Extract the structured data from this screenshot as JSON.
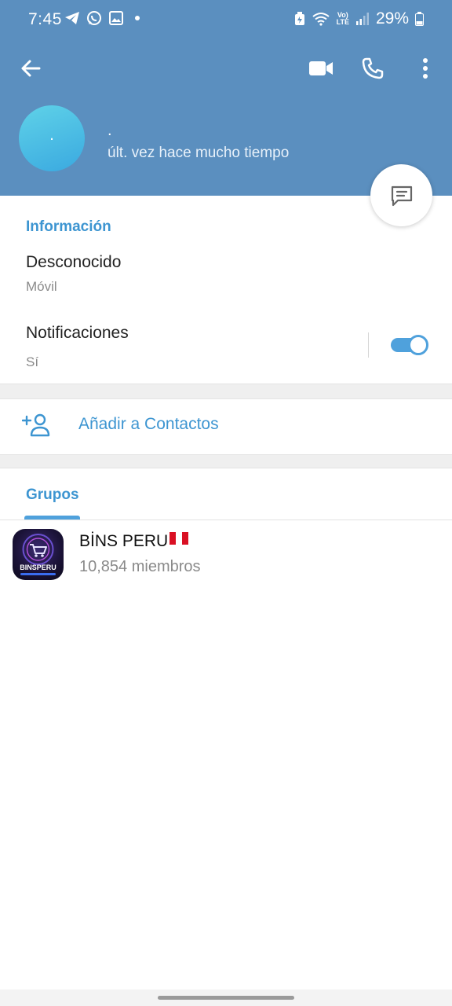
{
  "status_bar": {
    "time": "7:45",
    "battery_percent": "29%",
    "volte_line1": "Vo)",
    "volte_line2": "LTE"
  },
  "contact": {
    "name": ".",
    "initial": ".",
    "last_seen": "últ. vez hace mucho tiempo"
  },
  "info": {
    "section_title": "Información",
    "phone_value": "Desconocido",
    "phone_label": "Móvil",
    "notifications_label": "Notificaciones",
    "notifications_value": "Sí",
    "notifications_enabled": true
  },
  "actions": {
    "add_contact_label": "Añadir a Contactos"
  },
  "tabs": {
    "groups_label": "Grupos"
  },
  "groups": [
    {
      "name": "BİNS PERU",
      "members": "10,854 miembros",
      "avatar_text": "BINSPERU"
    }
  ],
  "colors": {
    "header": "#5b8fbf",
    "accent": "#3d95d1",
    "toggle": "#4fa1dc"
  },
  "icons": [
    "back-icon",
    "video-call-icon",
    "phone-icon",
    "more-vert-icon",
    "message-icon",
    "add-contact-icon",
    "peru-flag-icon"
  ]
}
